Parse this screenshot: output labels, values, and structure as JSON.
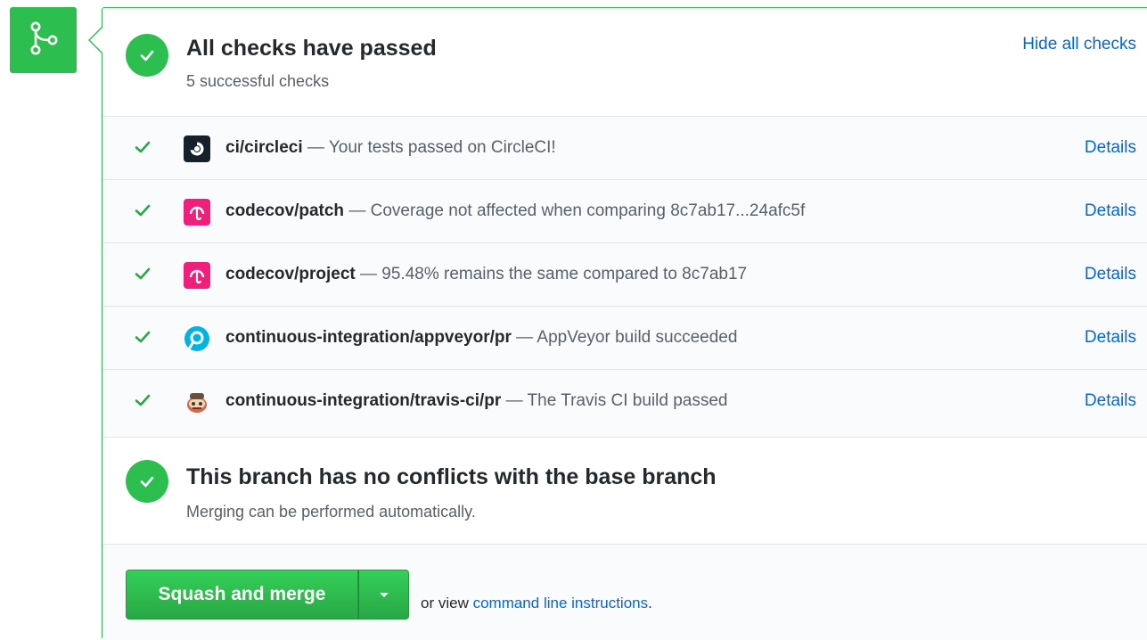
{
  "icons": {
    "merge_badge": "git-merge-icon",
    "status": "check-circle-icon",
    "row_status": "check-icon",
    "dropdown": "caret-down-icon"
  },
  "colors": {
    "success_green": "#2cbe4e",
    "link_blue": "#0366d6",
    "codecov_pink": "#f01f7a",
    "circleci_dark": "#16202a",
    "appveyor_blue": "#00b3e0"
  },
  "checks_summary": {
    "title": "All checks have passed",
    "subtitle": "5 successful checks",
    "toggle_label": "Hide all checks"
  },
  "checks": [
    {
      "name": "ci/circleci",
      "separator": " — ",
      "description": "Your tests passed on CircleCI!",
      "details_label": "Details",
      "avatar": "circleci-logo"
    },
    {
      "name": "codecov/patch",
      "separator": " — ",
      "description": "Coverage not affected when comparing 8c7ab17...24afc5f",
      "details_label": "Details",
      "avatar": "codecov-logo"
    },
    {
      "name": "codecov/project",
      "separator": " — ",
      "description": "95.48% remains the same compared to 8c7ab17",
      "details_label": "Details",
      "avatar": "codecov-logo"
    },
    {
      "name": "continuous-integration/appveyor/pr",
      "separator": " — ",
      "description": "AppVeyor build succeeded",
      "details_label": "Details",
      "avatar": "appveyor-logo"
    },
    {
      "name": "continuous-integration/travis-ci/pr",
      "separator": " — ",
      "description": "The Travis CI build passed",
      "details_label": "Details",
      "avatar": "travis-ci-logo"
    }
  ],
  "conflicts": {
    "title": "This branch has no conflicts with the base branch",
    "subtitle": "Merging can be performed automatically."
  },
  "merge": {
    "button_label": "Squash and merge",
    "or_view": "or view ",
    "cli_link": "command line instructions",
    "period": "."
  }
}
